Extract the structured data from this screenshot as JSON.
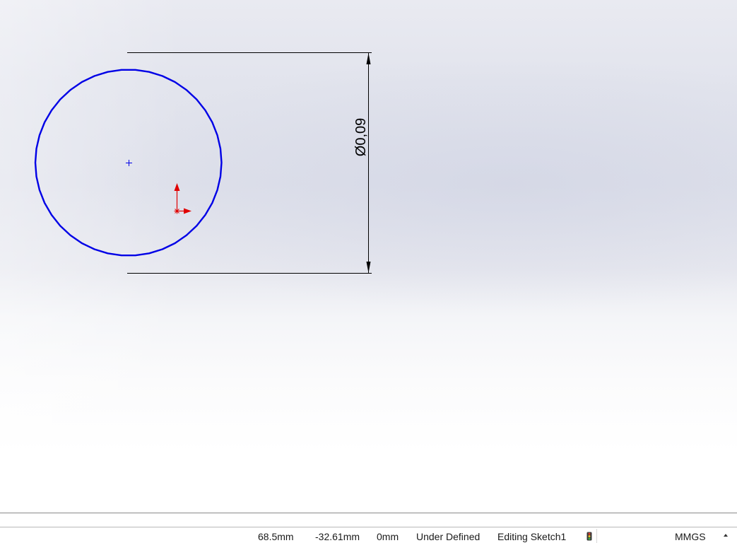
{
  "canvas": {
    "dimension_label": "Ø0,09",
    "colors": {
      "sketch_curve": "#0000e6",
      "dimension_line": "#000000",
      "origin_marker": "#e00000"
    },
    "icons": [
      "center-point-icon",
      "sketch-origin-icon",
      "dimension-arrow-icon"
    ]
  },
  "status_bar": {
    "x_coord": "68.5mm",
    "y_coord": "-32.61mm",
    "z_coord": "0mm",
    "sketch_state": "Under Defined",
    "edit_mode": "Editing Sketch1",
    "units": "MMGS",
    "icons": [
      "rebuild-traffic-light-icon",
      "units-menu-arrow-icon"
    ]
  }
}
